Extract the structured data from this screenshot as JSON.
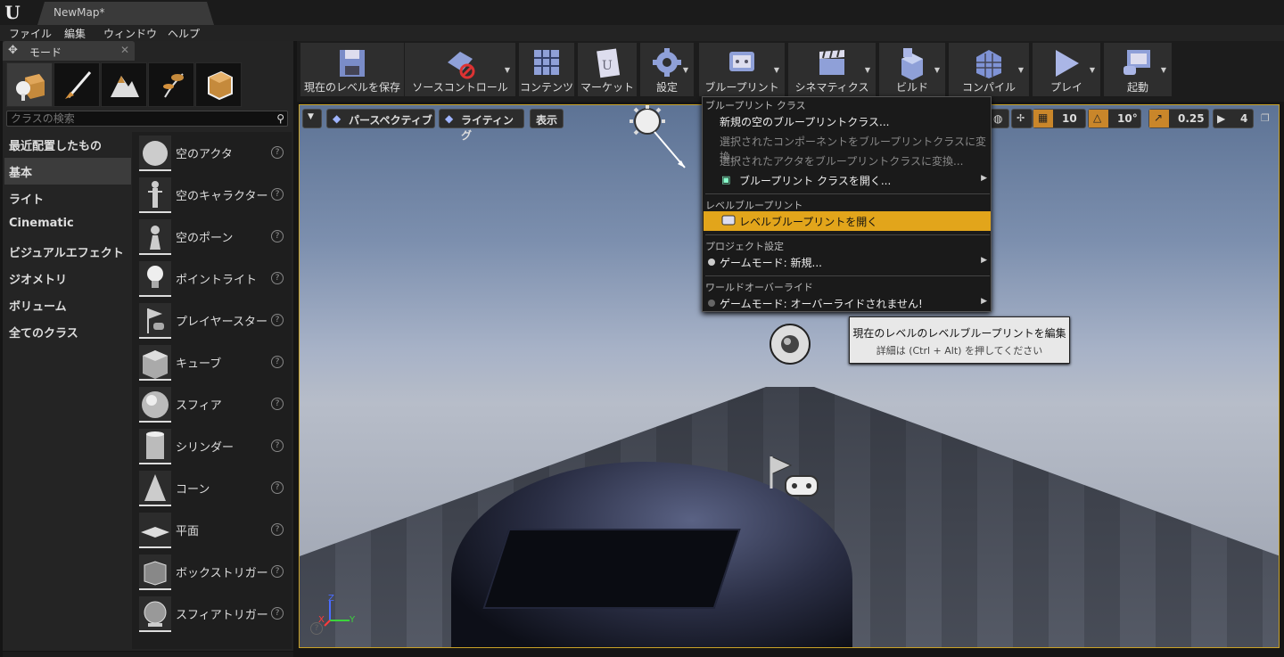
{
  "window": {
    "doc_tab": "NewMap*"
  },
  "menubar": [
    "ファイル",
    "編集",
    "ウィンドウ",
    "ヘルプ"
  ],
  "modes_panel": {
    "tab_label": "モード",
    "mode_icons": [
      "place-mode-icon",
      "paint-mode-icon",
      "landscape-mode-icon",
      "foliage-mode-icon",
      "geometry-mode-icon"
    ],
    "search_placeholder": "クラスの検索",
    "categories": [
      "最近配置したもの",
      "基本",
      "ライト",
      "Cinematic",
      "ビジュアルエフェクト",
      "ジオメトリ",
      "ボリューム",
      "全てのクラス"
    ],
    "selected_category": "基本",
    "items": [
      "空のアクタ",
      "空のキャラクター",
      "空のポーン",
      "ポイントライト",
      "プレイヤースター",
      "キューブ",
      "スフィア",
      "シリンダー",
      "コーン",
      "平面",
      "ボックストリガー",
      "スフィアトリガー"
    ]
  },
  "toolbar": {
    "buttons": [
      {
        "label": "現在のレベルを保存",
        "icon": "save-icon"
      },
      {
        "label": "ソースコントロール",
        "icon": "source-control-icon"
      },
      {
        "label": "コンテンツ",
        "icon": "content-icon"
      },
      {
        "label": "マーケット",
        "icon": "marketplace-icon"
      },
      {
        "label": "設定",
        "icon": "settings-icon"
      },
      {
        "label": "ブループリント",
        "icon": "blueprint-icon"
      },
      {
        "label": "シネマティクス",
        "icon": "cinematics-icon"
      },
      {
        "label": "ビルド",
        "icon": "build-icon"
      },
      {
        "label": "コンパイル",
        "icon": "compile-icon"
      },
      {
        "label": "プレイ",
        "icon": "play-icon"
      },
      {
        "label": "起動",
        "icon": "launch-icon"
      }
    ]
  },
  "viewport": {
    "perspective_label": "パースペクティブ",
    "lighting_label": "ライティング",
    "show_label": "表示",
    "grid_snap": "10",
    "rotation_snap": "10°",
    "scale_snap": "0.25",
    "camera_speed": "4",
    "axis_z": "Z",
    "axis_y": "Y",
    "axis_x": "X"
  },
  "context_menu": {
    "header_blueprint_class": "ブループリント クラス",
    "new_blueprint": "新規の空のブループリントクラス...",
    "convert_components": "選択されたコンポーネントをブループリントクラスに変換...",
    "convert_actors": "選択されたアクタをブループリントクラスに変換...",
    "open_blueprint_class": "ブループリント クラスを開く...",
    "header_level_blueprint": "レベルブループリント",
    "open_level_blueprint": "レベルブループリントを開く",
    "header_project_settings": "プロジェクト設定",
    "game_mode_new": "ゲームモード: 新規...",
    "header_world_override": "ワールドオーバーライド",
    "game_mode_override": "ゲームモード: オーバーライドされません!"
  },
  "tooltip": {
    "title": "現在のレベルのレベルブループリントを編集",
    "hint": "詳細は (Ctrl + Alt) を押してください"
  },
  "colors": {
    "accent": "#e2a51b",
    "viewport_border": "#c9a227"
  }
}
